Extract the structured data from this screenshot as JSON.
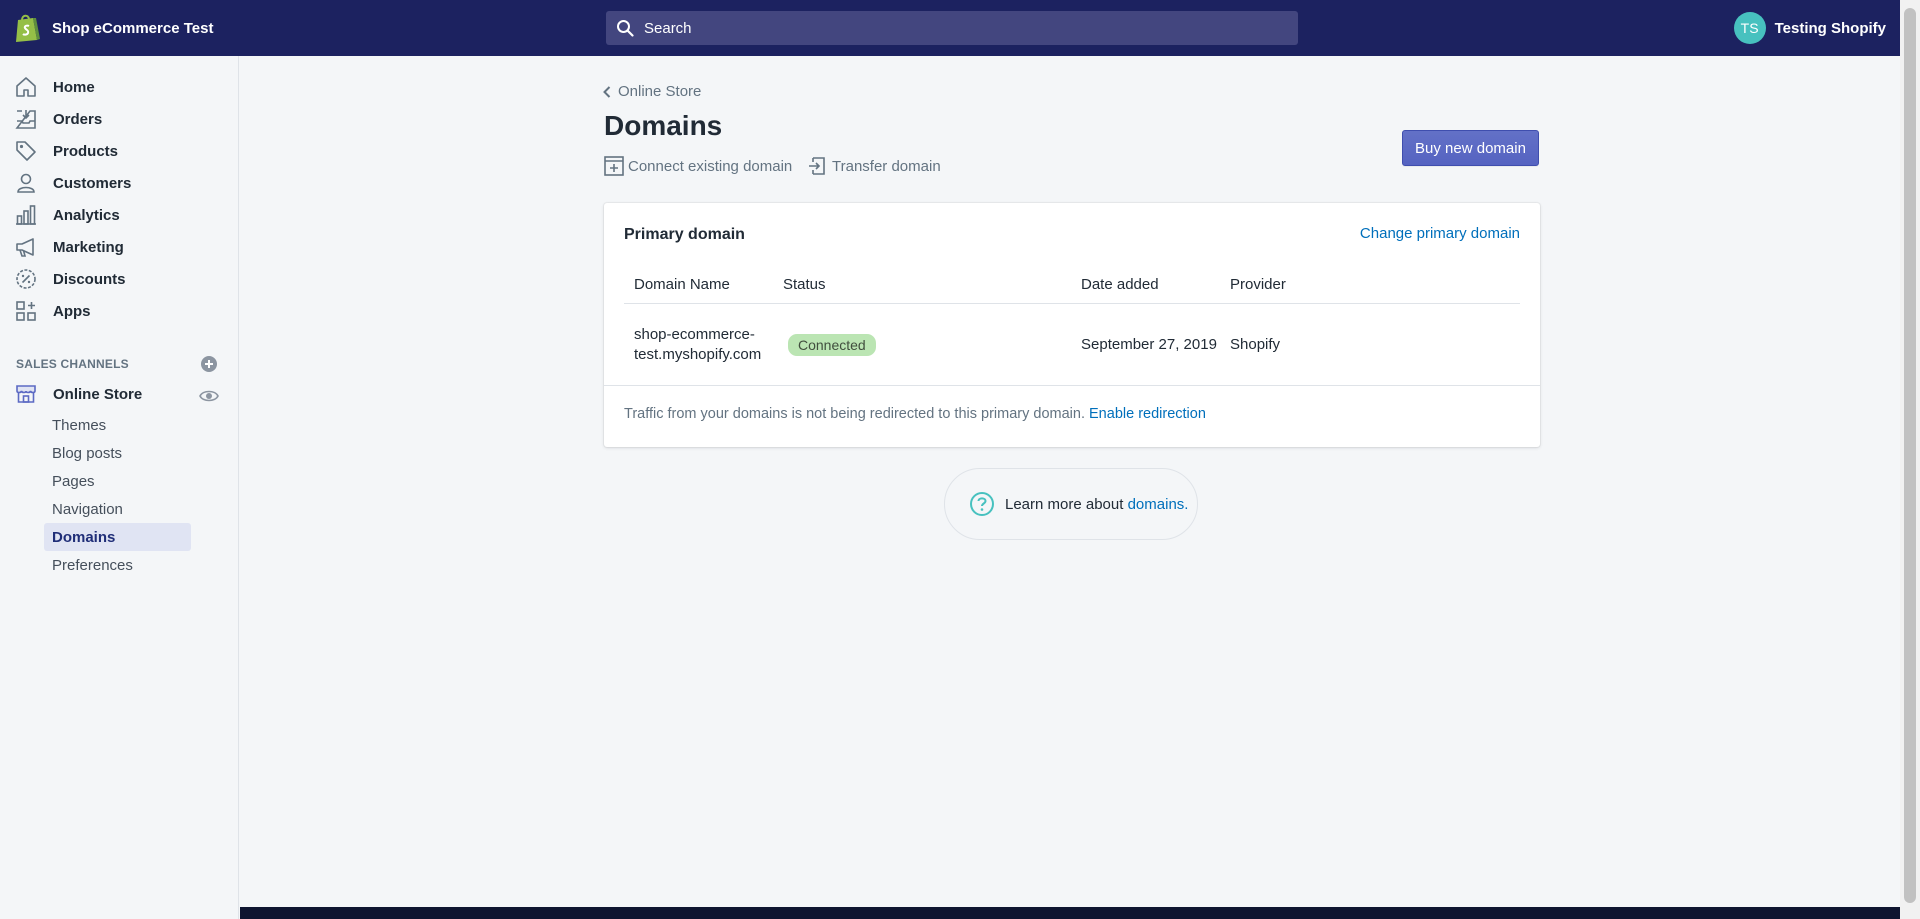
{
  "topbar": {
    "store_name": "Shop eCommerce Test",
    "search_placeholder": "Search",
    "user_initials": "TS",
    "user_name": "Testing Shopify"
  },
  "sidebar": {
    "items": [
      {
        "label": "Home",
        "icon": "home-icon"
      },
      {
        "label": "Orders",
        "icon": "orders-icon"
      },
      {
        "label": "Products",
        "icon": "tag-icon"
      },
      {
        "label": "Customers",
        "icon": "person-icon"
      },
      {
        "label": "Analytics",
        "icon": "bar-chart-icon"
      },
      {
        "label": "Marketing",
        "icon": "megaphone-icon"
      },
      {
        "label": "Discounts",
        "icon": "discount-icon"
      },
      {
        "label": "Apps",
        "icon": "apps-icon"
      }
    ],
    "sales_channels_title": "SALES CHANNELS",
    "online_store": "Online Store",
    "sub_items": [
      "Themes",
      "Blog posts",
      "Pages",
      "Navigation",
      "Domains",
      "Preferences"
    ],
    "active_sub_item": "Domains"
  },
  "main": {
    "breadcrumb": "Online Store",
    "title": "Domains",
    "actions": {
      "connect": "Connect existing domain",
      "transfer": "Transfer domain"
    },
    "buy_button": "Buy new domain",
    "card": {
      "title": "Primary domain",
      "change_link": "Change primary domain",
      "columns": [
        "Domain Name",
        "Status",
        "Date added",
        "Provider"
      ],
      "row": {
        "domain_line1": "shop-ecommerce-",
        "domain_line2": "test.myshopify.com",
        "status": "Connected",
        "date_added": "September 27, 2019",
        "provider": "Shopify"
      },
      "notice_text": "Traffic from your domains is not being redirected to this primary domain.",
      "notice_link": "Enable redirection"
    },
    "help": {
      "text": "Learn more about",
      "link": "domains."
    }
  },
  "colors": {
    "topbar": "#1c2260",
    "primary_button": "#5c6ac4",
    "link": "#006fbb",
    "badge_success": "#bbe5b3",
    "avatar": "#47c1bf"
  }
}
